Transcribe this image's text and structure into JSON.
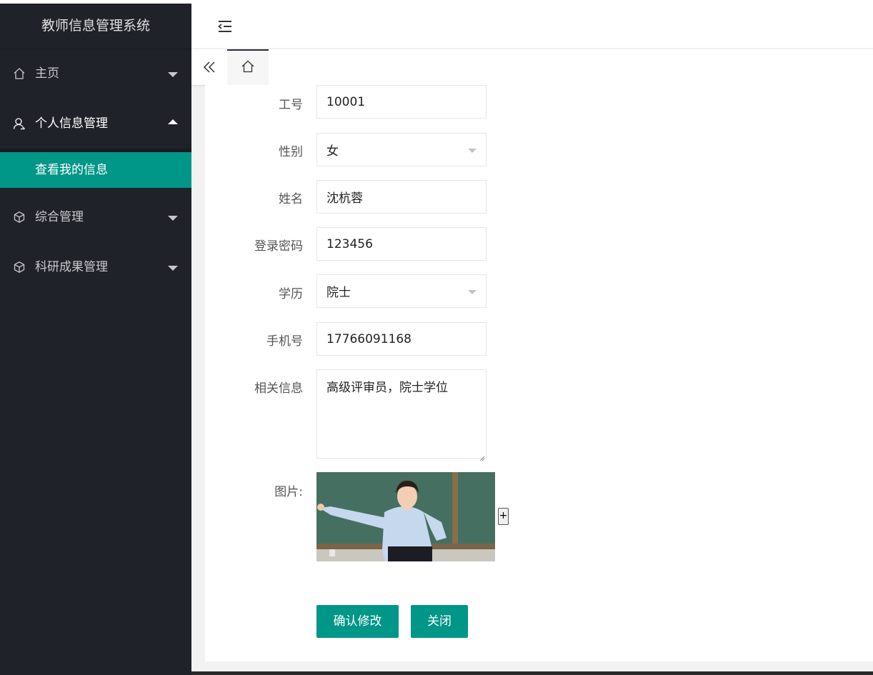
{
  "sidebar": {
    "logo": "教师信息管理系统",
    "items": [
      {
        "label": "主页",
        "icon": "home-icon",
        "expanded": false
      },
      {
        "label": "个人信息管理",
        "icon": "user-icon",
        "expanded": true,
        "children": [
          {
            "label": "查看我的信息",
            "active": true
          }
        ]
      },
      {
        "label": "综合管理",
        "icon": "cube-icon",
        "expanded": false
      },
      {
        "label": "科研成果管理",
        "icon": "cube-icon",
        "expanded": false
      }
    ]
  },
  "header": {
    "flexible_icon": "menu-fold-icon"
  },
  "tabs": {
    "prev_icon": "double-left-icon",
    "home_icon": "home-icon"
  },
  "form": {
    "fields": [
      {
        "label": "工号",
        "value": "10001",
        "type": "text"
      },
      {
        "label": "性别",
        "value": "女",
        "type": "select"
      },
      {
        "label": "姓名",
        "value": "沈杭蓉",
        "type": "text"
      },
      {
        "label": "登录密码",
        "value": "123456",
        "type": "text"
      },
      {
        "label": "学历",
        "value": "院士",
        "type": "select"
      },
      {
        "label": "手机号",
        "value": "17766091168",
        "type": "text"
      },
      {
        "label": "相关信息",
        "value": "高级评审员，院士学位",
        "type": "textarea"
      }
    ],
    "image_label": "图片:",
    "upload_label": "+",
    "confirm_label": "确认修改",
    "close_label": "关闭"
  },
  "colors": {
    "accent": "#009688",
    "sidebar_bg": "#20222a"
  }
}
